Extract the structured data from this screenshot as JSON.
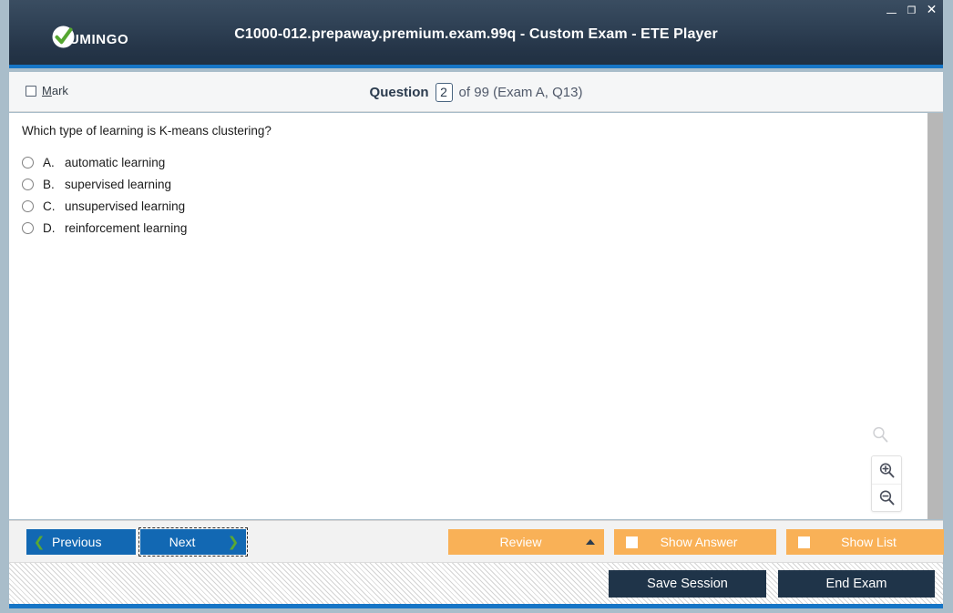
{
  "window": {
    "title": "C1000-012.prepaway.premium.exam.99q - Custom Exam - ETE Player",
    "minimize_label": "—",
    "maximize_label": "❐",
    "close_label": "✕",
    "logo_text": "UMINGO",
    "accent_color": "#1675c6",
    "titlebar_color": "#2f4155"
  },
  "header": {
    "mark_label_prefix": "M",
    "mark_label_rest": "ark",
    "question_word": "Question",
    "question_number": "2",
    "question_of": "of 99 (Exam A, Q13)"
  },
  "question": {
    "text": "Which type of learning is K-means clustering?",
    "answers": [
      {
        "letter": "A.",
        "text": "automatic learning",
        "selected": false
      },
      {
        "letter": "B.",
        "text": "supervised learning",
        "selected": false
      },
      {
        "letter": "C.",
        "text": "unsupervised learning",
        "selected": false
      },
      {
        "letter": "D.",
        "text": "reinforcement learning",
        "selected": false
      }
    ]
  },
  "zoom_controls": {
    "reset_icon": "magnifier-icon",
    "zoom_in_icon": "magnifier-plus-icon",
    "zoom_out_icon": "magnifier-minus-icon"
  },
  "navbar": {
    "previous_label": "Previous",
    "next_label": "Next",
    "review_label": "Review",
    "show_answer_label": "Show Answer",
    "show_list_label": "Show List",
    "button_blue": "#1268b3",
    "button_orange": "#f9b157",
    "chevron_green": "#5aa832"
  },
  "footer": {
    "save_session_label": "Save Session",
    "end_exam_label": "End Exam",
    "button_dark": "#1f3449"
  }
}
